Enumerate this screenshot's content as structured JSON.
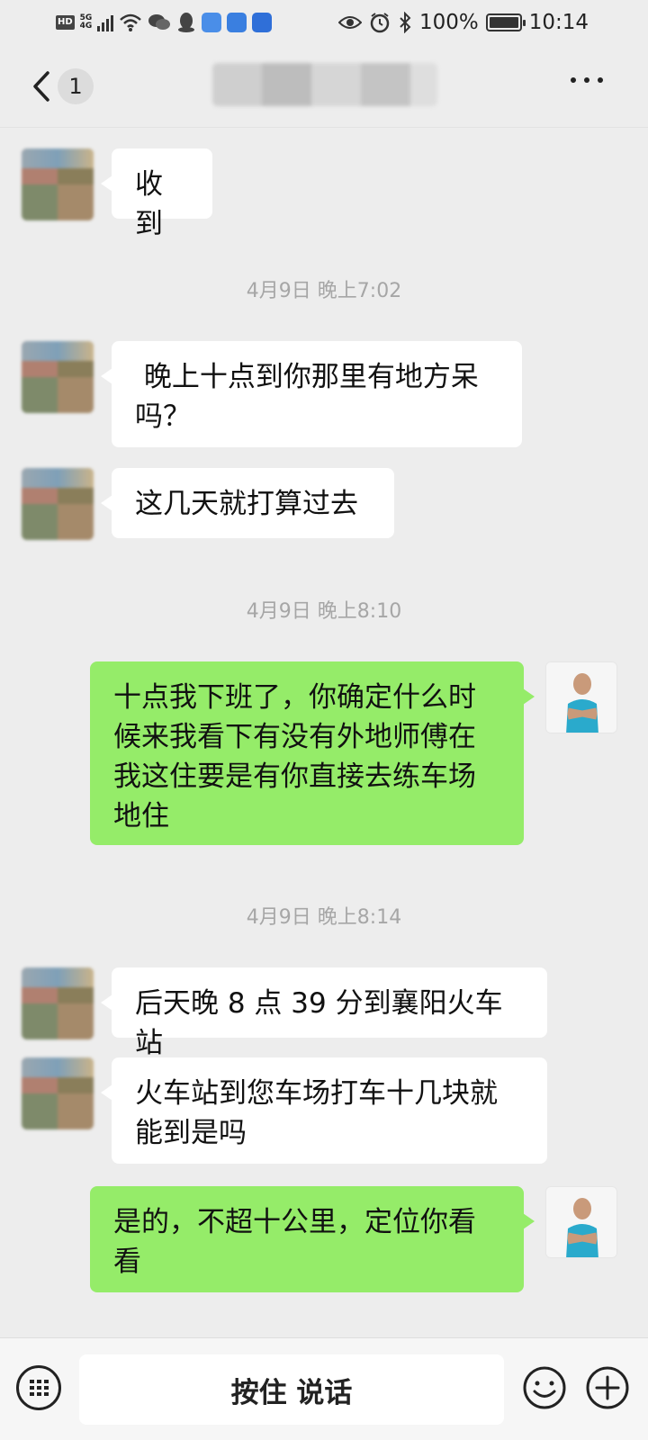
{
  "status_bar": {
    "hd": "HD",
    "net_top": "5G",
    "net_bottom": "4G",
    "battery_percent": "100%",
    "time": "10:14",
    "icons": [
      "hd-badge",
      "signal-icon",
      "wifi-icon",
      "wechat-icon",
      "qq-icon",
      "app-icon-1",
      "app-icon-2",
      "app-icon-3",
      "eye-icon",
      "alarm-icon",
      "bluetooth-icon",
      "battery-icon"
    ]
  },
  "nav": {
    "back_icon": "chevron-left-icon",
    "unread_count": "1",
    "title": "",
    "more_icon": "more-dots-icon"
  },
  "messages": [
    {
      "type": "text",
      "from": "other",
      "text": "收到"
    },
    {
      "type": "time",
      "text": "4月9日 晚上7:02"
    },
    {
      "type": "text",
      "from": "other",
      "text": " 晚上十点到你那里有地方呆\n吗？"
    },
    {
      "type": "text",
      "from": "other",
      "text": "这几天就打算过去"
    },
    {
      "type": "time",
      "text": "4月9日 晚上8:10"
    },
    {
      "type": "text",
      "from": "self",
      "text": "十点我下班了，你确定什么时\n候来我看下有没有外地师傅在\n我这住要是有你直接去练车场\n地住"
    },
    {
      "type": "time",
      "text": "4月9日 晚上8:14"
    },
    {
      "type": "text",
      "from": "other",
      "text": "后天晚 8 点 39 分到襄阳火车站"
    },
    {
      "type": "text",
      "from": "other",
      "text": "火车站到您车场打车十几块就\n能到是吗"
    },
    {
      "type": "text",
      "from": "self",
      "text": "是的，不超十公里，定位你看\n看"
    }
  ],
  "input_bar": {
    "keyboard_icon": "keyboard-icon",
    "hold_to_talk_label": "按住 说话",
    "emoji_icon": "emoji-icon",
    "plus_icon": "plus-icon"
  },
  "colors": {
    "background": "#ededed",
    "bubble_in": "#ffffff",
    "bubble_out": "#95ec69",
    "timestamp_text": "#a6a6a6"
  }
}
